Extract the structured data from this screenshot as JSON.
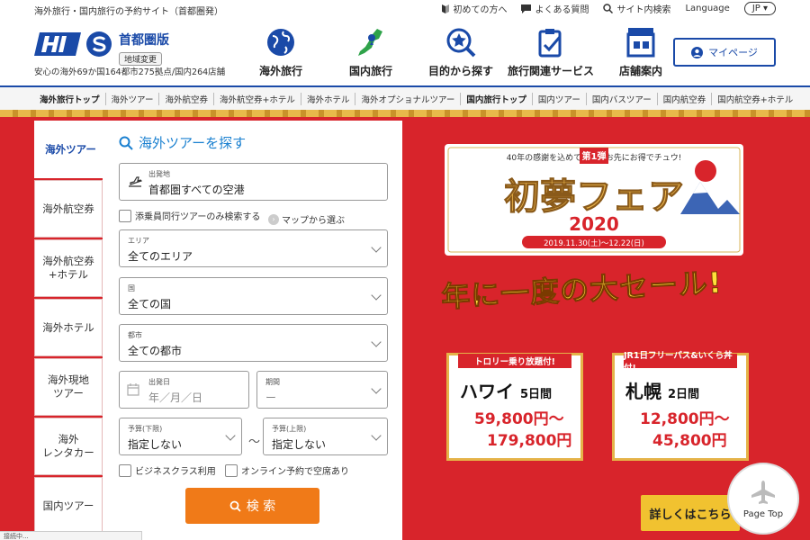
{
  "topbar": {
    "tagline": "海外旅行・国内旅行の予約サイト（首都圏発）",
    "links": [
      "初めての方へ",
      "よくある質問",
      "サイト内検索"
    ],
    "language_label": "Language",
    "language_value": "JP"
  },
  "header": {
    "region_name": "首都圏版",
    "region_change": "地域変更",
    "stat": "安心の海外69か国164都市275拠点/国内264店舗",
    "nav": [
      "海外旅行",
      "国内旅行",
      "目的から探す",
      "旅行関連サービス",
      "店舗案内"
    ],
    "mypage": "マイページ"
  },
  "subnav": [
    "海外旅行トップ",
    "海外ツアー",
    "海外航空券",
    "海外航空券+ホテル",
    "海外ホテル",
    "海外オプショナルツアー",
    "国内旅行トップ",
    "国内ツアー",
    "国内バスツアー",
    "国内航空券",
    "国内航空券+ホテル"
  ],
  "sidebar": [
    "海外ツアー",
    "海外航空券",
    "海外航空券\n+ホテル",
    "海外ホテル",
    "海外現地\nツアー",
    "海外\nレンタカー",
    "国内ツアー"
  ],
  "panel": {
    "title": "海外ツアーを探す",
    "origin_label": "出発地",
    "origin_value": "首都圏すべての空港",
    "escort_check": "添乗員同行ツアーのみ検索する",
    "map_select": "マップから選ぶ",
    "area_label": "エリア",
    "area_value": "全てのエリア",
    "country_label": "国",
    "country_value": "全ての国",
    "city_label": "都市",
    "city_value": "全ての都市",
    "date_label": "出発日",
    "date_value": "年／月／日",
    "period_label": "期間",
    "period_value": "ー",
    "budget_min_label": "予算(下限)",
    "budget_min_value": "指定しない",
    "budget_max_label": "予算(上限)",
    "budget_max_value": "指定しない",
    "tilde": "〜",
    "business_check": "ビジネスクラス利用",
    "online_check": "オンライン予約で空席あり",
    "search_button": "検 索"
  },
  "banner": {
    "fair_top": "40年の感謝を込めて、一足お先にお得でチュウ!",
    "fair_badge": "第1弾",
    "fair_title": "初夢フェア",
    "fair_year": "2020",
    "fair_period": "2019.11.30(土)〜12.22(日)",
    "headline": "年に一度の大セール!",
    "cards": [
      {
        "ribbon": "トロリー乗り放題付!",
        "dest": "ハワイ",
        "days": "5日間",
        "price_from": "59,800円〜",
        "price_to": "179,800円"
      },
      {
        "ribbon": "JR1日フリーパス&いくら丼付!",
        "dest": "札幌",
        "days": "2日間",
        "price_from": "12,800円〜",
        "price_to": "45,800円"
      }
    ],
    "detail_button": "詳しくはこちら",
    "page_top": "Page Top"
  },
  "status_text": "接続中...",
  "colors": {
    "brand": "#1a4aa8",
    "hero_red": "#d8242b",
    "search_orange": "#f07a18",
    "gold": "#e5b348"
  }
}
